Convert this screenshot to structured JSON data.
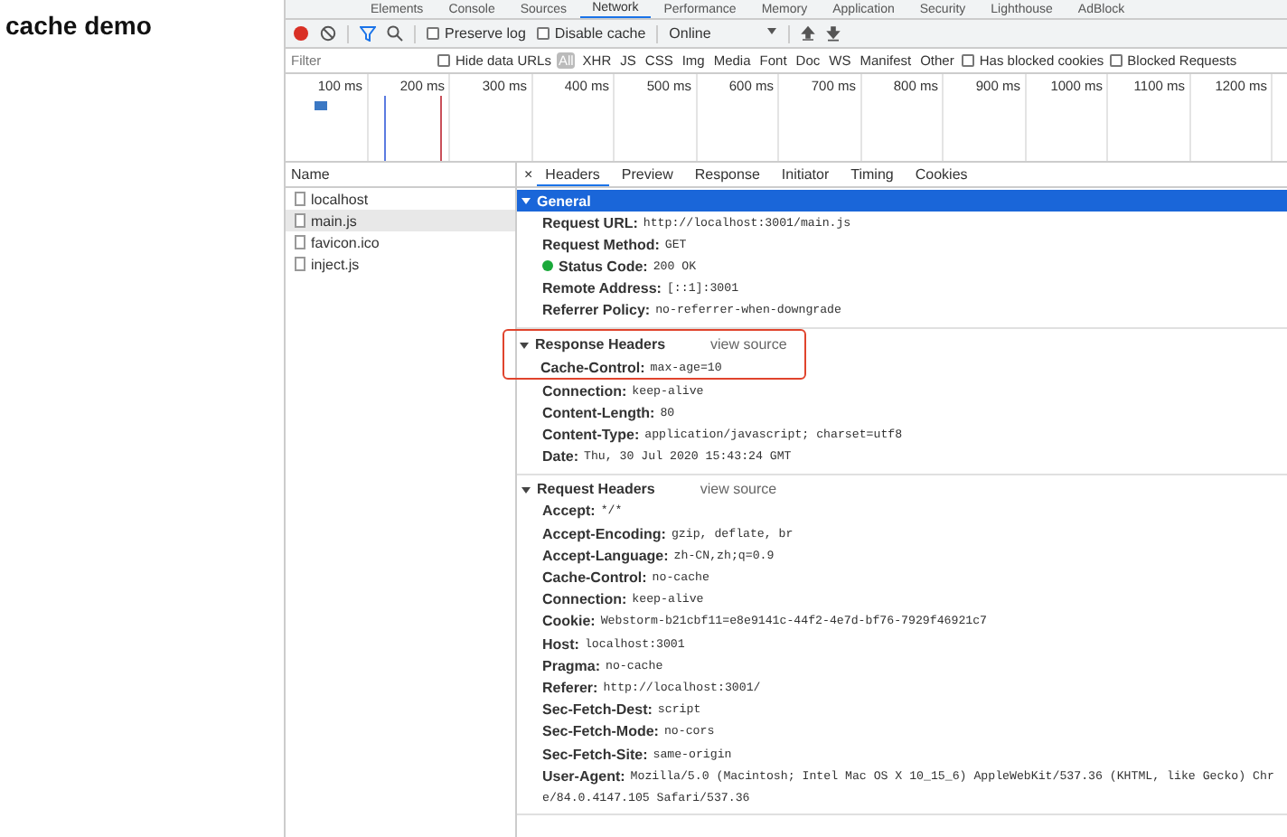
{
  "page": {
    "heading": "cache demo"
  },
  "devtools": {
    "tabs": [
      {
        "label": "Elements",
        "selected": false
      },
      {
        "label": "Console",
        "selected": false
      },
      {
        "label": "Sources",
        "selected": false
      },
      {
        "label": "Network",
        "selected": true
      },
      {
        "label": "Performance",
        "selected": false
      },
      {
        "label": "Memory",
        "selected": false
      },
      {
        "label": "Application",
        "selected": false
      },
      {
        "label": "Security",
        "selected": false
      },
      {
        "label": "Lighthouse",
        "selected": false
      },
      {
        "label": "AdBlock",
        "selected": false
      }
    ],
    "toolbar": {
      "recording": true,
      "filter_on": true,
      "checkboxes": [
        {
          "label": "Preserve log",
          "checked": false
        },
        {
          "label": "Disable cache",
          "checked": false
        }
      ],
      "throttling": "Online"
    },
    "filter_bar": {
      "placeholder": "Filter",
      "hide_data_urls": {
        "label": "Hide data URLs",
        "checked": false
      },
      "types": [
        {
          "label": "All",
          "selected": true
        },
        {
          "label": "XHR",
          "selected": false
        },
        {
          "label": "JS",
          "selected": false
        },
        {
          "label": "CSS",
          "selected": false
        },
        {
          "label": "Img",
          "selected": false
        },
        {
          "label": "Media",
          "selected": false
        },
        {
          "label": "Font",
          "selected": false
        },
        {
          "label": "Doc",
          "selected": false
        },
        {
          "label": "WS",
          "selected": false
        },
        {
          "label": "Manifest",
          "selected": false
        },
        {
          "label": "Other",
          "selected": false
        }
      ],
      "extra_checkboxes": [
        {
          "label": "Has blocked cookies",
          "checked": false
        },
        {
          "label": "Blocked Requests",
          "checked": false
        }
      ]
    },
    "timeline": {
      "ticks": [
        "100 ms",
        "200 ms",
        "300 ms",
        "400 ms",
        "500 ms",
        "600 ms",
        "700 ms",
        "800 ms",
        "900 ms",
        "1000 ms",
        "1100 ms",
        "1200 ms"
      ]
    },
    "requests": {
      "column": "Name",
      "rows": [
        {
          "name": "localhost",
          "selected": false
        },
        {
          "name": "main.js",
          "selected": true
        },
        {
          "name": "favicon.ico",
          "selected": false
        },
        {
          "name": "inject.js",
          "selected": false
        }
      ]
    },
    "detail_tabs": {
      "close": "×",
      "tabs": [
        {
          "label": "Headers",
          "selected": true
        },
        {
          "label": "Preview",
          "selected": false
        },
        {
          "label": "Response",
          "selected": false
        },
        {
          "label": "Initiator",
          "selected": false
        },
        {
          "label": "Timing",
          "selected": false
        },
        {
          "label": "Cookies",
          "selected": false
        }
      ]
    },
    "sections": [
      {
        "title": "General",
        "selected": true,
        "highlighted": false,
        "rows": [
          {
            "kind": "text",
            "name": "Request URL:",
            "value": "http://localhost:3001/main.js"
          },
          {
            "kind": "text",
            "name": "Request Method:",
            "value": "GET"
          },
          {
            "kind": "status",
            "name": "Status Code:",
            "value": "200 OK"
          },
          {
            "kind": "text",
            "name": "Remote Address:",
            "value": "[::1]:3001"
          },
          {
            "kind": "text",
            "name": "Referrer Policy:",
            "value": "no-referrer-when-downgrade"
          }
        ]
      },
      {
        "title": "Response Headers",
        "link": "view source",
        "selected": false,
        "highlighted": true,
        "rows": [
          {
            "kind": "text",
            "name": "Cache-Control:",
            "value": "max-age=10"
          },
          {
            "kind": "text",
            "name": "Connection:",
            "value": "keep-alive"
          },
          {
            "kind": "text",
            "name": "Content-Length:",
            "value": "80"
          },
          {
            "kind": "text",
            "name": "Content-Type:",
            "value": "application/javascript; charset=utf8"
          },
          {
            "kind": "text",
            "name": "Date:",
            "value": "Thu, 30 Jul 2020 15:43:24 GMT"
          }
        ]
      },
      {
        "title": "Request Headers",
        "link": "view source",
        "selected": false,
        "highlighted": false,
        "rows": [
          {
            "kind": "text",
            "name": "Accept:",
            "value": "*/*"
          },
          {
            "kind": "text",
            "name": "Accept-Encoding:",
            "value": "gzip, deflate, br"
          },
          {
            "kind": "text",
            "name": "Accept-Language:",
            "value": "zh-CN,zh;q=0.9"
          },
          {
            "kind": "text",
            "name": "Cache-Control:",
            "value": "no-cache"
          },
          {
            "kind": "text",
            "name": "Connection:",
            "value": "keep-alive"
          },
          {
            "kind": "text",
            "name": "Cookie:",
            "value": "Webstorm-b21cbf11=e8e9141c-44f2-4e7d-bf76-7929f46921c7"
          },
          {
            "kind": "text",
            "name": "Host:",
            "value": "localhost:3001"
          },
          {
            "kind": "text",
            "name": "Pragma:",
            "value": "no-cache"
          },
          {
            "kind": "text",
            "name": "Referer:",
            "value": "http://localhost:3001/"
          },
          {
            "kind": "text",
            "name": "Sec-Fetch-Dest:",
            "value": "script"
          },
          {
            "kind": "text",
            "name": "Sec-Fetch-Mode:",
            "value": "no-cors"
          },
          {
            "kind": "text",
            "name": "Sec-Fetch-Site:",
            "value": "same-origin"
          },
          {
            "kind": "text",
            "name": "User-Agent:",
            "value": "Mozilla/5.0 (Macintosh; Intel Mac OS X 10_15_6) AppleWebKit/537.36 (KHTML, like Gecko) Chr",
            "continuation": "e/84.0.4147.105 Safari/537.36"
          }
        ]
      }
    ]
  }
}
